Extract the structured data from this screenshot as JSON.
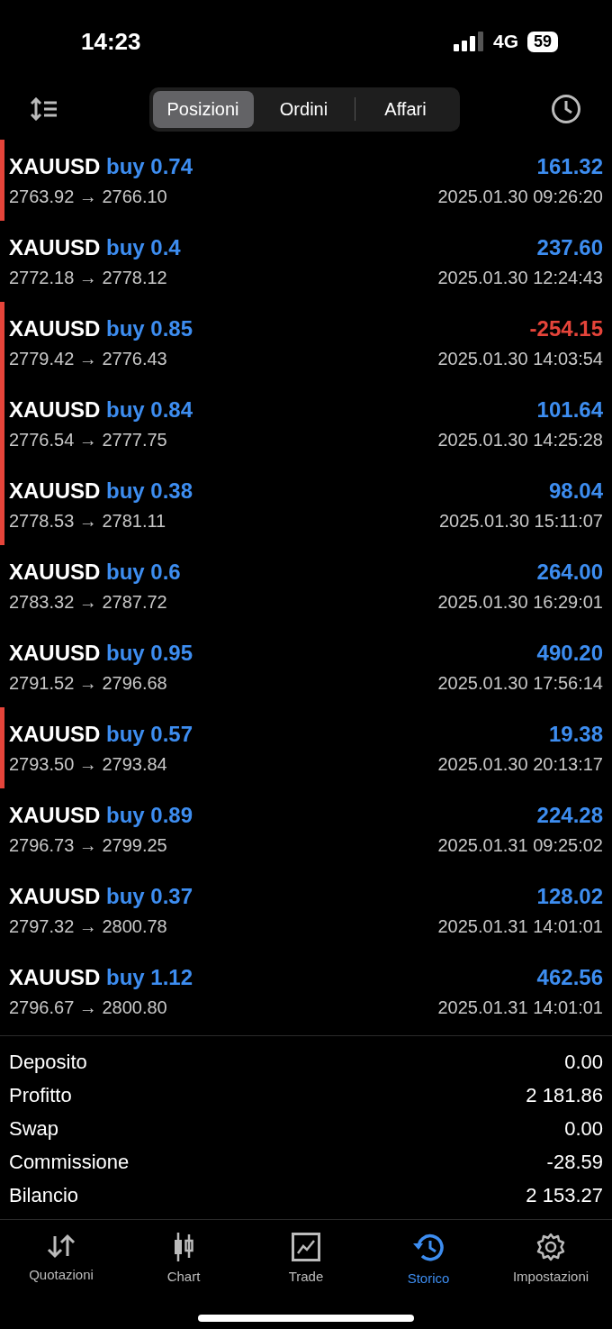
{
  "status_bar": {
    "time": "14:23",
    "network": "4G",
    "battery": "59"
  },
  "tabs": [
    {
      "label": "Posizioni",
      "selected": true
    },
    {
      "label": "Ordini",
      "selected": false
    },
    {
      "label": "Affari",
      "selected": false
    }
  ],
  "deals": [
    {
      "symbol": "XAUUSD",
      "side": "buy 0.74",
      "prices": "2763.92 → 2766.10",
      "profit": "161.32",
      "negative": false,
      "flagged": true,
      "time": "2025.01.30 09:26:20"
    },
    {
      "symbol": "XAUUSD",
      "side": "buy 0.4",
      "prices": "2772.18 → 2778.12",
      "profit": "237.60",
      "negative": false,
      "flagged": false,
      "time": "2025.01.30 12:24:43"
    },
    {
      "symbol": "XAUUSD",
      "side": "buy 0.85",
      "prices": "2779.42 → 2776.43",
      "profit": "-254.15",
      "negative": true,
      "flagged": true,
      "time": "2025.01.30 14:03:54"
    },
    {
      "symbol": "XAUUSD",
      "side": "buy 0.84",
      "prices": "2776.54 → 2777.75",
      "profit": "101.64",
      "negative": false,
      "flagged": true,
      "time": "2025.01.30 14:25:28"
    },
    {
      "symbol": "XAUUSD",
      "side": "buy 0.38",
      "prices": "2778.53 → 2781.11",
      "profit": "98.04",
      "negative": false,
      "flagged": true,
      "time": "2025.01.30 15:11:07"
    },
    {
      "symbol": "XAUUSD",
      "side": "buy 0.6",
      "prices": "2783.32 → 2787.72",
      "profit": "264.00",
      "negative": false,
      "flagged": false,
      "time": "2025.01.30 16:29:01"
    },
    {
      "symbol": "XAUUSD",
      "side": "buy 0.95",
      "prices": "2791.52 → 2796.68",
      "profit": "490.20",
      "negative": false,
      "flagged": false,
      "time": "2025.01.30 17:56:14"
    },
    {
      "symbol": "XAUUSD",
      "side": "buy 0.57",
      "prices": "2793.50 → 2793.84",
      "profit": "19.38",
      "negative": false,
      "flagged": true,
      "time": "2025.01.30 20:13:17"
    },
    {
      "symbol": "XAUUSD",
      "side": "buy 0.89",
      "prices": "2796.73 → 2799.25",
      "profit": "224.28",
      "negative": false,
      "flagged": false,
      "time": "2025.01.31 09:25:02"
    },
    {
      "symbol": "XAUUSD",
      "side": "buy 0.37",
      "prices": "2797.32 → 2800.78",
      "profit": "128.02",
      "negative": false,
      "flagged": false,
      "time": "2025.01.31 14:01:01"
    },
    {
      "symbol": "XAUUSD",
      "side": "buy 1.12",
      "prices": "2796.67 → 2800.80",
      "profit": "462.56",
      "negative": false,
      "flagged": false,
      "time": "2025.01.31 14:01:01"
    }
  ],
  "summary": [
    {
      "label": "Deposito",
      "value": "0.00"
    },
    {
      "label": "Profitto",
      "value": "2 181.86"
    },
    {
      "label": "Swap",
      "value": "0.00"
    },
    {
      "label": "Commissione",
      "value": "-28.59"
    },
    {
      "label": "Bilancio",
      "value": "2 153.27"
    }
  ],
  "nav": [
    {
      "kind": "quotes",
      "label": "Quotazioni",
      "selected": false
    },
    {
      "kind": "chart",
      "label": "Chart",
      "selected": false
    },
    {
      "kind": "trade",
      "label": "Trade",
      "selected": false
    },
    {
      "kind": "history",
      "label": "Storico",
      "selected": true
    },
    {
      "kind": "settings",
      "label": "Impostazioni",
      "selected": false
    }
  ]
}
